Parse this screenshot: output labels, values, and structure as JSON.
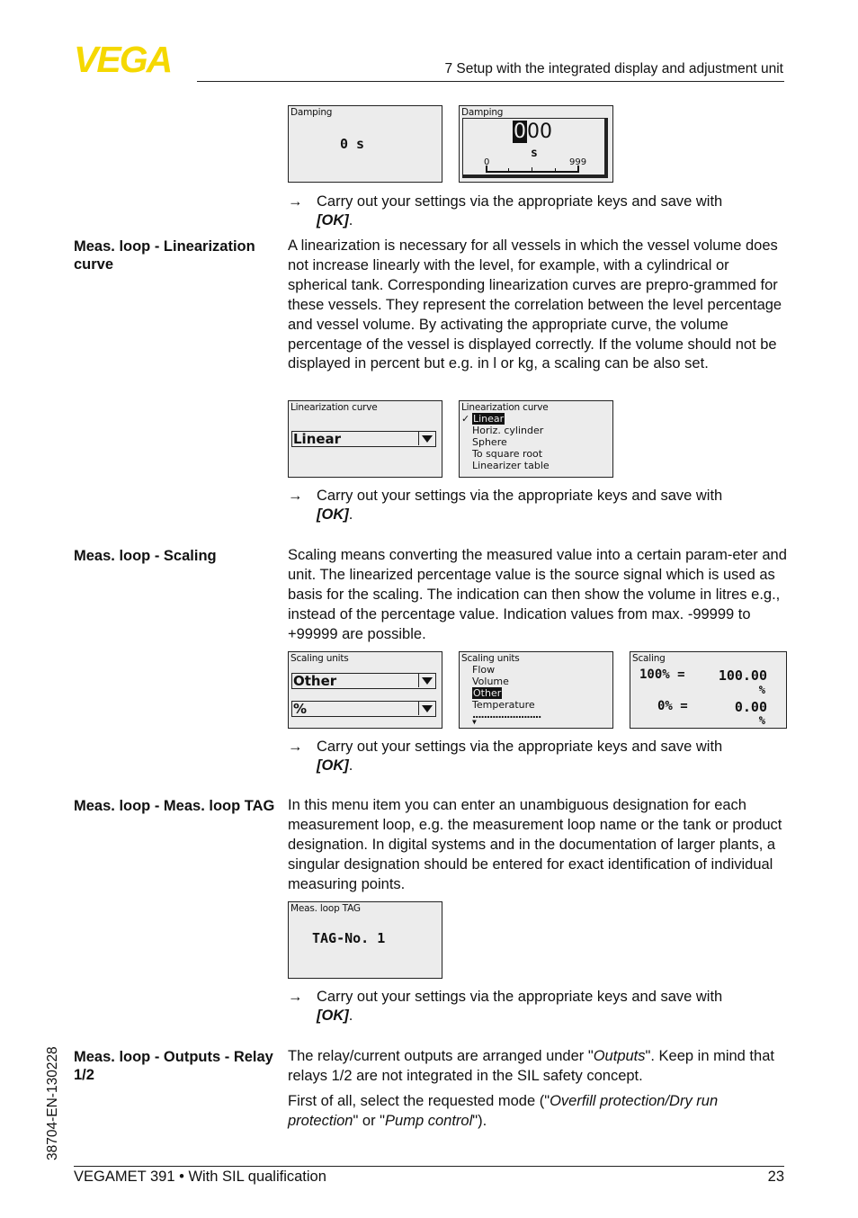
{
  "header": {
    "logo_text": "VEGA",
    "brand_color": "#f5d800",
    "section_title": "7 Setup with the integrated display and adjustment unit"
  },
  "common": {
    "arrow": "→",
    "step_text": "Carry out your settings via the appropriate keys and save with",
    "ok_label": "[OK]",
    "period": "."
  },
  "damping": {
    "screen1": {
      "title": "Damping",
      "value": "0 s"
    },
    "screen2": {
      "title": "Damping",
      "digit_selected": "0",
      "digits_rest": "00",
      "unit": "s",
      "scale_min": "0",
      "scale_max": "999"
    }
  },
  "linearization": {
    "label": "Meas. loop - Linearization curve",
    "paragraph": "A linearization is necessary for all vessels in which the vessel volume does not increase linearly with the level, for example, with a cylindrical or spherical tank. Corresponding linearization curves are prepro-grammed for these vessels. They represent the correlation between the level percentage and vessel volume. By activating the appropriate curve, the volume percentage of the vessel is displayed correctly. If the volume should not be displayed in percent but e.g. in l or kg, a scaling can be also set.",
    "screen1": {
      "title": "Linearization curve",
      "selected": "Linear"
    },
    "screen2": {
      "title": "Linearization curve",
      "check": "✓",
      "options": [
        "Linear",
        "Horiz. cylinder",
        "Sphere",
        "To square root",
        "Linearizer table"
      ],
      "selected_index": 0
    }
  },
  "scaling": {
    "label": "Meas. loop - Scaling",
    "paragraph": "Scaling means converting the measured value into a certain param-eter and unit. The linearized percentage value is the source signal which is used as basis for the scaling. The indication can then show the volume in litres e.g., instead of the percentage value. Indication values from max. -99999 to +99999 are possible.",
    "screen1": {
      "title": "Scaling units",
      "select1": "Other",
      "select2": "%"
    },
    "screen2": {
      "title": "Scaling units",
      "options": [
        "Flow",
        "Volume",
        "Other",
        "Temperature"
      ],
      "selected_index": 2,
      "more": "........................",
      "down_arrow": "▼"
    },
    "screen3": {
      "title": "Scaling",
      "row1_label": "100% =",
      "row1_value": "100.00",
      "row1_unit": "%",
      "row2_label": "0% =",
      "row2_value": "0.00",
      "row2_unit": "%"
    }
  },
  "tag": {
    "label": "Meas. loop - Meas. loop TAG",
    "paragraph": "In this menu item you can enter an unambiguous designation for each measurement loop, e.g. the measurement loop name or the tank or product designation. In digital systems and in the documentation of larger plants, a singular designation should be entered for exact identification of individual measuring points.",
    "screen": {
      "title": "Meas. loop TAG",
      "value": "TAG-No. 1"
    }
  },
  "outputs": {
    "label": "Meas. loop - Outputs - Relay 1/2",
    "p1_a": "The relay/current outputs are arranged under \"",
    "p1_i": "Outputs",
    "p1_b": "\". Keep in mind that relays 1/2 are not integrated in the SIL safety concept.",
    "p2_a": "First of all, select the requested mode (\"",
    "p2_i1": "Overfill protection/Dry run protection",
    "p2_b": "\" or \"",
    "p2_i2": "Pump control",
    "p2_c": "\")."
  },
  "footer": {
    "left": "VEGAMET 391 • With SIL qualification",
    "page_number": "23",
    "doc_id": "38704-EN-130228"
  }
}
